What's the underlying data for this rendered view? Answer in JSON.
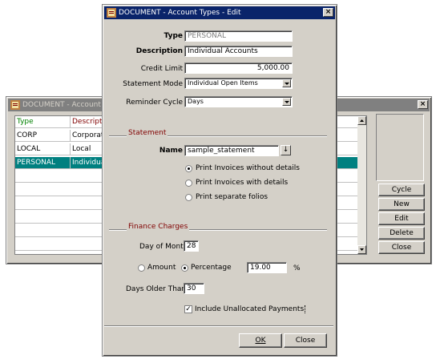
{
  "back_window": {
    "title": "DOCUMENT - Account Types",
    "columns": [
      "Type",
      "Description"
    ],
    "rows": [
      {
        "type": "CORP",
        "description": "Corporate",
        "selected": false
      },
      {
        "type": "LOCAL",
        "description": "Local",
        "selected": false
      },
      {
        "type": "PERSONAL",
        "description": "Individual",
        "selected": true
      }
    ],
    "buttons": [
      "Cycle",
      "New",
      "Edit",
      "Delete",
      "Close"
    ]
  },
  "edit_dialog": {
    "title": "DOCUMENT - Account Types - Edit",
    "type_label": "Type",
    "type_value": "PERSONAL",
    "description_label": "Description",
    "description_value": "Individual Accounts",
    "credit_limit_label": "Credit Limit",
    "credit_limit_value": "5,000.00",
    "statement_mode_label": "Statement Mode",
    "statement_mode_value": "Individual Open Items",
    "reminder_cycle_label": "Reminder Cycle",
    "reminder_cycle_value": "Days",
    "statement_section": "Statement",
    "name_label": "Name",
    "name_value": "sample_statement",
    "lov_glyph": "↓",
    "print_options": [
      {
        "label": "Print Invoices without details",
        "selected": true
      },
      {
        "label": "Print Invoices with details",
        "selected": false
      },
      {
        "label": "Print separate folios",
        "selected": false
      }
    ],
    "finance_section": "Finance Charges",
    "day_of_month_label": "Day of Month",
    "day_of_month_value": "28",
    "amount_label": "Amount",
    "amount_selected": false,
    "percentage_label": "Percentage",
    "percentage_selected": true,
    "percentage_value": "19.00",
    "percent_sign": "%",
    "days_older_label": "Days Older Than",
    "days_older_value": "30",
    "include_unallocated_label": "Include Unallocated Payments",
    "include_unallocated_checked": true,
    "check_mark": "✓",
    "ok_label": "OK",
    "close_label": "Close"
  },
  "colors": {
    "title_active": "#0a246a",
    "title_inactive": "#808080",
    "selection": "#008080",
    "section_title": "#800000",
    "face": "#d4d0c8"
  },
  "icons": {
    "window": "document-app-icon",
    "close": "close-icon"
  }
}
